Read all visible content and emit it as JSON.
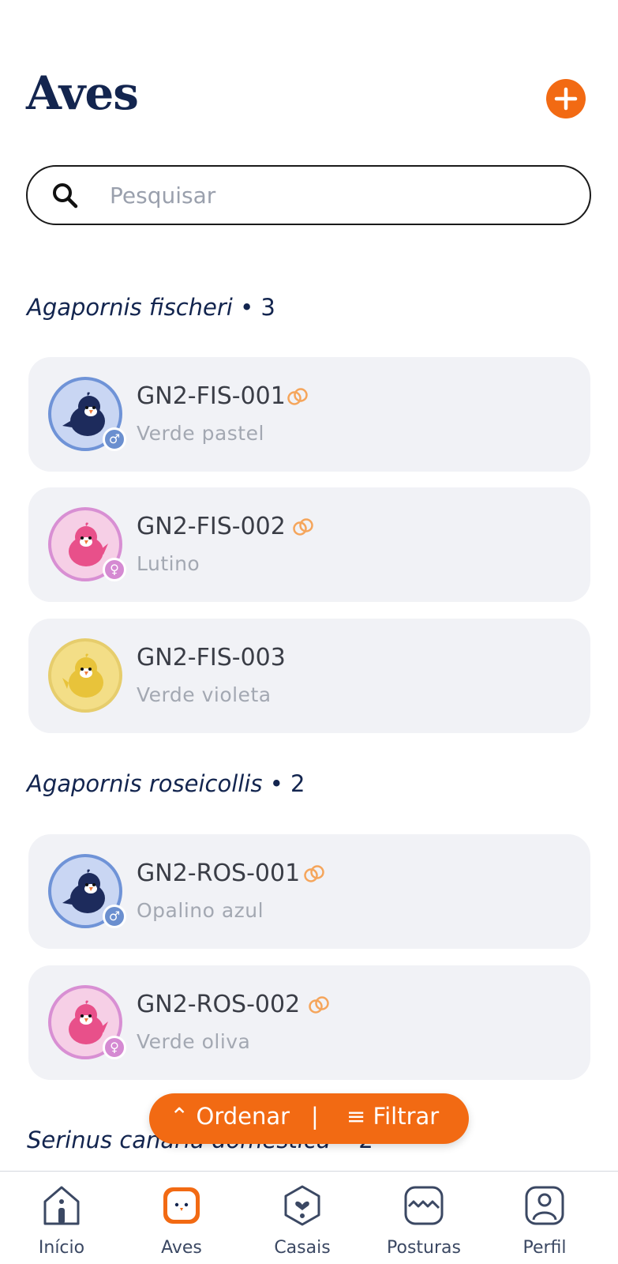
{
  "header": {
    "title": "Aves",
    "add_icon": "plus-icon"
  },
  "search": {
    "placeholder": "Pesquisar",
    "value": ""
  },
  "groups": [
    {
      "species": "Agapornis fischeri",
      "count": "• 3",
      "birds": [
        {
          "code": "GN2-FIS-001",
          "mutation": "Verde pastel",
          "sex": "male",
          "sex_symbol": "♂",
          "ringed": true,
          "avatar_color": "#c9d6f3"
        },
        {
          "code": "GN2-FIS-002",
          "mutation": "Lutino",
          "sex": "female",
          "sex_symbol": "♀",
          "ringed": true,
          "avatar_color": "#f6cfe6"
        },
        {
          "code": "GN2-FIS-003",
          "mutation": "Verde violeta",
          "sex": "unknown",
          "sex_symbol": "",
          "ringed": false,
          "avatar_color": "#f3de87"
        }
      ]
    },
    {
      "species": "Agapornis roseicollis",
      "count": "• 2",
      "birds": [
        {
          "code": "GN2-ROS-001",
          "mutation": "Opalino azul",
          "sex": "male",
          "sex_symbol": "♂",
          "ringed": true,
          "avatar_color": "#c9d6f3"
        },
        {
          "code": "GN2-ROS-002",
          "mutation": "Verde oliva",
          "sex": "female",
          "sex_symbol": "♀",
          "ringed": true,
          "avatar_color": "#f6cfe6"
        }
      ]
    },
    {
      "species": "Serinus canaria domestica",
      "count": "• 2",
      "birds": []
    }
  ],
  "actions": {
    "sort_label": "⌃ Ordenar",
    "divider": "|",
    "filter_label": "≡ Filtrar"
  },
  "nav": [
    {
      "label": "Início",
      "icon": "home-icon",
      "active": false
    },
    {
      "label": "Aves",
      "icon": "bird-icon",
      "active": true
    },
    {
      "label": "Casais",
      "icon": "couple-heart-icon",
      "active": false
    },
    {
      "label": "Posturas",
      "icon": "eggs-icon",
      "active": false
    },
    {
      "label": "Perfil",
      "icon": "profile-icon",
      "active": false
    }
  ],
  "colors": {
    "accent": "#f26a13",
    "title": "#13254f",
    "male": "#6b8fcf",
    "female": "#d58ad2",
    "ring": "#f5a55b",
    "card_bg": "#f1f2f6"
  }
}
